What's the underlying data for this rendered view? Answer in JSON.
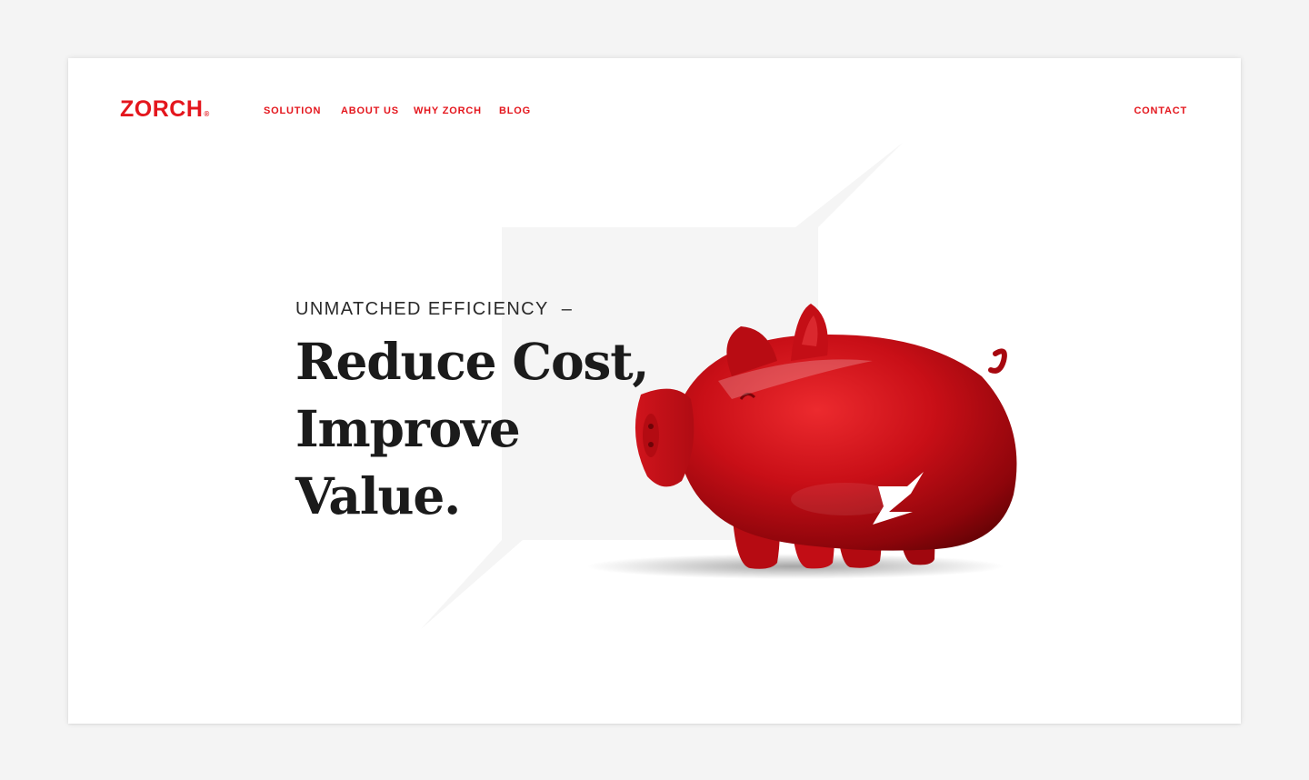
{
  "brand": {
    "name": "ZORCH",
    "registered_mark": "®",
    "accent_color": "#e4161d"
  },
  "nav": {
    "items": [
      {
        "label": "SOLUTION"
      },
      {
        "label": "ABOUT US"
      },
      {
        "label": "WHY ZORCH"
      },
      {
        "label": "BLOG"
      }
    ],
    "contact_label": "CONTACT"
  },
  "hero": {
    "eyebrow": "UNMATCHED EFFICIENCY",
    "eyebrow_dash": "–",
    "headline": [
      "Reduce Cost,",
      "Improve",
      "Value."
    ],
    "image": {
      "icon": "piggy-bank-icon",
      "badge_icon": "zorch-z-icon",
      "color": "#c8101a"
    }
  }
}
